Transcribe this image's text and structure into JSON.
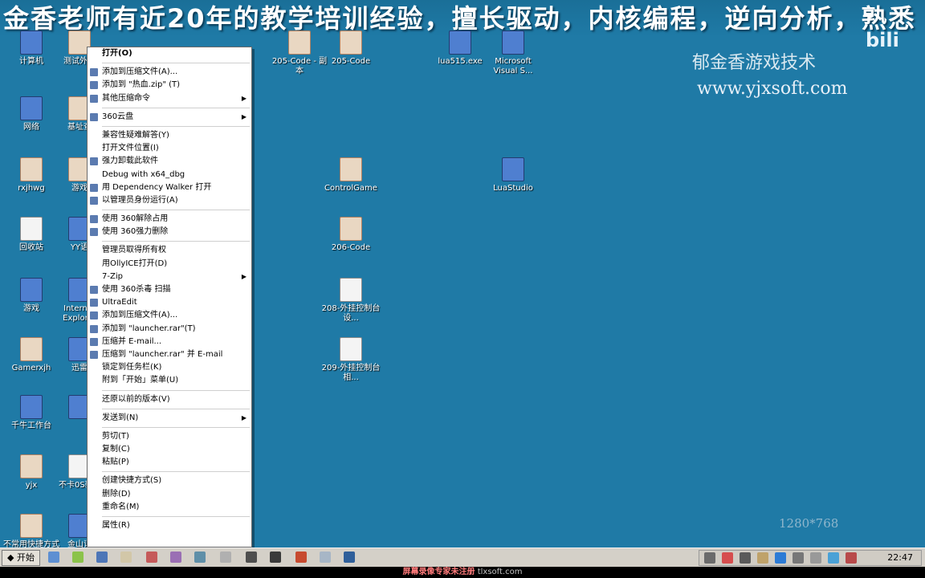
{
  "banner": {
    "text": "金香老师有近20年的教学培训经验，擅长驱动，内核编程，逆向分析，熟悉"
  },
  "watermarks": {
    "line1": "郁金香游戏技术",
    "line2": "www.yjxsoft.com",
    "resolution": "1280*768",
    "bili": "bili"
  },
  "desktop": {
    "icons": [
      {
        "label": "计算机",
        "kind": "app"
      },
      {
        "label": "测试外挂",
        "kind": "folder"
      },
      {
        "label": "网络",
        "kind": "app"
      },
      {
        "label": "基址查",
        "kind": "folder"
      },
      {
        "label": "rxjhwg",
        "kind": "folder"
      },
      {
        "label": "游戏",
        "kind": "folder"
      },
      {
        "label": "回收站",
        "kind": "doc"
      },
      {
        "label": "YY语",
        "kind": "app"
      },
      {
        "label": "游戏",
        "kind": "app"
      },
      {
        "label": "Internet Explorer",
        "kind": "app"
      },
      {
        "label": "Gamerxjh",
        "kind": "folder"
      },
      {
        "label": "迅雷",
        "kind": "app"
      },
      {
        "label": "千牛工作台",
        "kind": "app"
      },
      {
        "label": "",
        "kind": "app"
      },
      {
        "label": "yjx",
        "kind": "folder"
      },
      {
        "label": "不卡0S新.e",
        "kind": "doc"
      },
      {
        "label": "不常用快捷方式",
        "kind": "folder"
      },
      {
        "label": "金山词",
        "kind": "app"
      },
      {
        "label": "205-Code - 副本",
        "kind": "folder"
      },
      {
        "label": "205-Code",
        "kind": "folder"
      },
      {
        "label": "lua515.exe",
        "kind": "app"
      },
      {
        "label": "Microsoft Visual S...",
        "kind": "app"
      },
      {
        "label": "ControlGame",
        "kind": "folder"
      },
      {
        "label": "LuaStudio",
        "kind": "app"
      },
      {
        "label": "206-Code",
        "kind": "folder"
      },
      {
        "label": "208-外挂控制台设...",
        "kind": "doc"
      },
      {
        "label": "209-外挂控制台相...",
        "kind": "doc"
      }
    ]
  },
  "context_menu": {
    "items": [
      {
        "label": "打开(O)",
        "bold": true
      },
      {
        "sep": true
      },
      {
        "label": "添加到压缩文件(A)...",
        "icon": true
      },
      {
        "label": "添加到 \"热血.zip\" (T)",
        "icon": true
      },
      {
        "label": "其他压缩命令",
        "icon": true,
        "submenu": true
      },
      {
        "sep": true
      },
      {
        "label": "360云盘",
        "icon": true,
        "submenu": true
      },
      {
        "sep": true
      },
      {
        "label": "兼容性疑难解答(Y)"
      },
      {
        "label": "打开文件位置(I)"
      },
      {
        "label": "强力卸载此软件",
        "icon": true
      },
      {
        "label": "Debug with x64_dbg"
      },
      {
        "label": "用 Dependency Walker 打开",
        "icon": true
      },
      {
        "label": "以管理员身份运行(A)",
        "icon": true
      },
      {
        "sep": true
      },
      {
        "label": "使用 360解除占用",
        "icon": true
      },
      {
        "label": "使用 360强力删除",
        "icon": true
      },
      {
        "sep": true
      },
      {
        "label": "管理员取得所有权"
      },
      {
        "label": "用OllyICE打开(D)"
      },
      {
        "label": "7-Zip",
        "submenu": true
      },
      {
        "label": "使用 360杀毒 扫描",
        "icon": true
      },
      {
        "label": "UltraEdit",
        "icon": true
      },
      {
        "label": "添加到压缩文件(A)...",
        "icon": true
      },
      {
        "label": "添加到 \"launcher.rar\"(T)",
        "icon": true
      },
      {
        "label": "压缩并 E-mail...",
        "icon": true
      },
      {
        "label": "压缩到 \"launcher.rar\" 并 E-mail",
        "icon": true
      },
      {
        "label": "锁定到任务栏(K)"
      },
      {
        "label": "附到「开始」菜单(U)"
      },
      {
        "sep": true
      },
      {
        "label": "还原以前的版本(V)"
      },
      {
        "sep": true
      },
      {
        "label": "发送到(N)",
        "submenu": true
      },
      {
        "sep": true
      },
      {
        "label": "剪切(T)"
      },
      {
        "label": "复制(C)"
      },
      {
        "label": "粘贴(P)"
      },
      {
        "sep": true
      },
      {
        "label": "创建快捷方式(S)"
      },
      {
        "label": "删除(D)"
      },
      {
        "label": "重命名(M)"
      },
      {
        "sep": true
      },
      {
        "label": "属性(R)"
      }
    ]
  },
  "taskbar": {
    "start_label": "开始",
    "clock": "22:47"
  },
  "bottom_bar": {
    "badge": "屏幕录像专家未注册",
    "site": "tlxsoft.com"
  }
}
